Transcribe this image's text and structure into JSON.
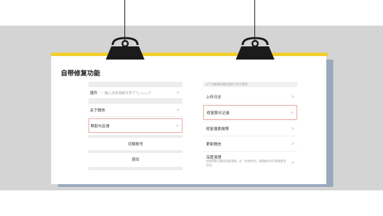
{
  "page": {
    "title": "自带修复功能"
  },
  "left_panel": {
    "plugin_label": "插件",
    "plugin_hint": "♡ 输入法支持颜文字了°(｡•ᴗ•｡)°",
    "about_label": "关于微信",
    "help_label": "帮助与反馈",
    "switch_label": "切换账号",
    "logout_label": "退出"
  },
  "right_panel": {
    "note": "以下功能请在微信团队引导下使用",
    "items": [
      {
        "label": "上传日志"
      },
      {
        "label": "修复聊天记录"
      },
      {
        "label": "修复搜索故障"
      },
      {
        "label": "更新微信"
      },
      {
        "label": "深度清理",
        "desc": "仅填得默认使用深度清理。在「存储空间」清理缓存时可释放更多空间。"
      }
    ]
  },
  "colors": {
    "accent_yellow": "#f2cf2d",
    "shadow_blue": "#9aaabd",
    "highlight_border": "#e8a69f"
  },
  "icons": [
    "binder-clip-icon",
    "chevron-right-icon"
  ]
}
